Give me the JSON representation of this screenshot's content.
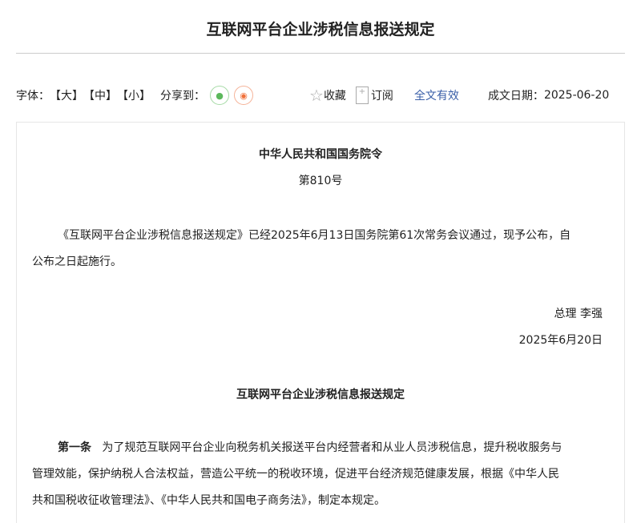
{
  "title": "互联网平台企业涉税信息报送规定",
  "toolbar": {
    "font_label": "字体：",
    "font_large": "【大】",
    "font_medium": "【中】",
    "font_small": "【小】",
    "share_label": "分享到：",
    "favorite": "收藏",
    "subscribe": "订阅",
    "validity": "全文有效",
    "date_label": "成文日期：",
    "date": "2025-06-20"
  },
  "colors": {
    "link": "#3a5fa8",
    "wechat": "#5cb85c",
    "weibo": "#f0703a"
  },
  "doc": {
    "order_title": "中华人民共和国国务院令",
    "order_no": "第810号",
    "intro_1": "《互联网平台企业涉税信息报送规定》已经2025年6月13日国务院第61次常务会议通过，现予公布，自",
    "intro_2": "公布之日起施行。",
    "signer": "总理 李强",
    "sign_date": "2025年6月20日",
    "reg_title": "互联网平台企业涉税信息报送规定",
    "art1_label": "第一条",
    "art1_1": "为了规范互联网平台企业向税务机关报送平台内经营者和从业人员涉税信息，提升税收服务与",
    "art1_2": "管理效能，保护纳税人合法权益，营造公平统一的税收环境，促进平台经济规范健康发展，根据《中华人民",
    "art1_3": "共和国税收征收管理法》、《中华人民共和国电子商务法》，制定本规定。"
  }
}
